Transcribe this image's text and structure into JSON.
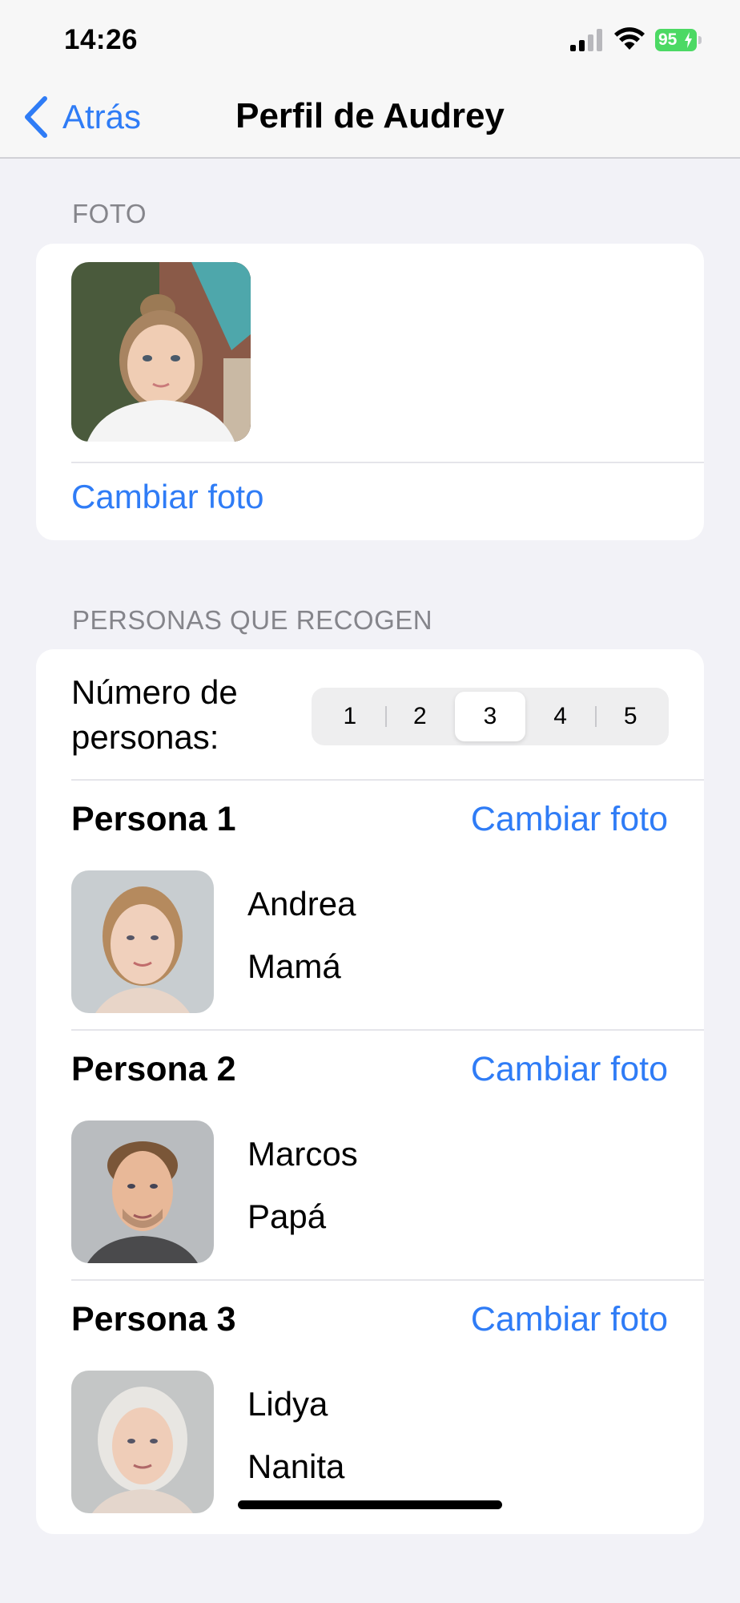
{
  "status_bar": {
    "time": "14:26",
    "battery": "95"
  },
  "nav": {
    "back_label": "Atrás",
    "title": "Perfil de Audrey"
  },
  "photo_section": {
    "header": "FOTO",
    "change_photo": "Cambiar foto"
  },
  "pickup_section": {
    "header": "PERSONAS QUE RECOGEN",
    "count_label": "Número de personas:",
    "options": [
      "1",
      "2",
      "3",
      "4",
      "5"
    ],
    "selected_option": "3",
    "persons": [
      {
        "title": "Persona 1",
        "change_photo": "Cambiar foto",
        "name": "Andrea",
        "relation": "Mamá"
      },
      {
        "title": "Persona 2",
        "change_photo": "Cambiar foto",
        "name": "Marcos",
        "relation": "Papá"
      },
      {
        "title": "Persona 3",
        "change_photo": "Cambiar foto",
        "name": "Lidya",
        "relation": "Nanita"
      }
    ]
  },
  "colors": {
    "accent": "#2f7cf6",
    "background": "#f2f2f7",
    "battery": "#4cd964"
  }
}
